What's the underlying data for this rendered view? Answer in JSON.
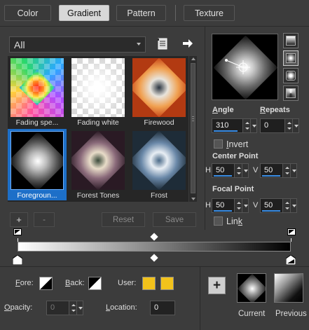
{
  "tabs": [
    {
      "label": "Color",
      "active": false
    },
    {
      "label": "Gradient",
      "active": true
    },
    {
      "label": "Pattern",
      "active": false
    },
    {
      "label": "Texture",
      "active": false
    }
  ],
  "library": {
    "category": "All",
    "items": [
      {
        "label": "Fading spe...",
        "selected": false
      },
      {
        "label": "Fading white",
        "selected": false
      },
      {
        "label": "Firewood",
        "selected": false
      },
      {
        "label": "Foregroun...",
        "selected": true
      },
      {
        "label": "Forest Tones",
        "selected": false
      },
      {
        "label": "Frost",
        "selected": false
      }
    ],
    "add_label": "+",
    "remove_label": "-",
    "reset_label": "Reset",
    "save_label": "Save"
  },
  "angle": {
    "label_pre": "",
    "label_u": "A",
    "label_post": "ngle",
    "value": "310"
  },
  "repeats": {
    "label_pre": "",
    "label_u": "R",
    "label_post": "epeats",
    "value": "0"
  },
  "invert": {
    "label_pre": "",
    "label_u": "I",
    "label_post": "nvert",
    "checked": false
  },
  "center_point": {
    "label": "Center Point",
    "h_label": "H",
    "h": "50",
    "v_label": "V",
    "v": "50"
  },
  "focal_point": {
    "label": "Focal Point",
    "h_label": "H",
    "h": "50",
    "v_label": "V",
    "v": "50"
  },
  "link": {
    "label_pre": "Lin",
    "label_u": "k",
    "label_post": "",
    "checked": false
  },
  "bottom": {
    "fore_pre": "",
    "fore_u": "F",
    "fore_post": "ore:",
    "back_pre": "",
    "back_u": "B",
    "back_post": "ack:",
    "user_label": "User:",
    "user_color_1": "#f2c21b",
    "user_color_2": "#f2c21b",
    "opacity_pre": "",
    "opacity_u": "O",
    "opacity_post": "pacity:",
    "opacity_value": "0",
    "location_pre": "",
    "location_u": "L",
    "location_post": "ocation:",
    "location_value": "0",
    "add_label": "+",
    "current_label": "Current",
    "previous_label": "Previous"
  },
  "colors": {
    "accent": "#3a8ee6",
    "selection": "#1d6fc8"
  }
}
